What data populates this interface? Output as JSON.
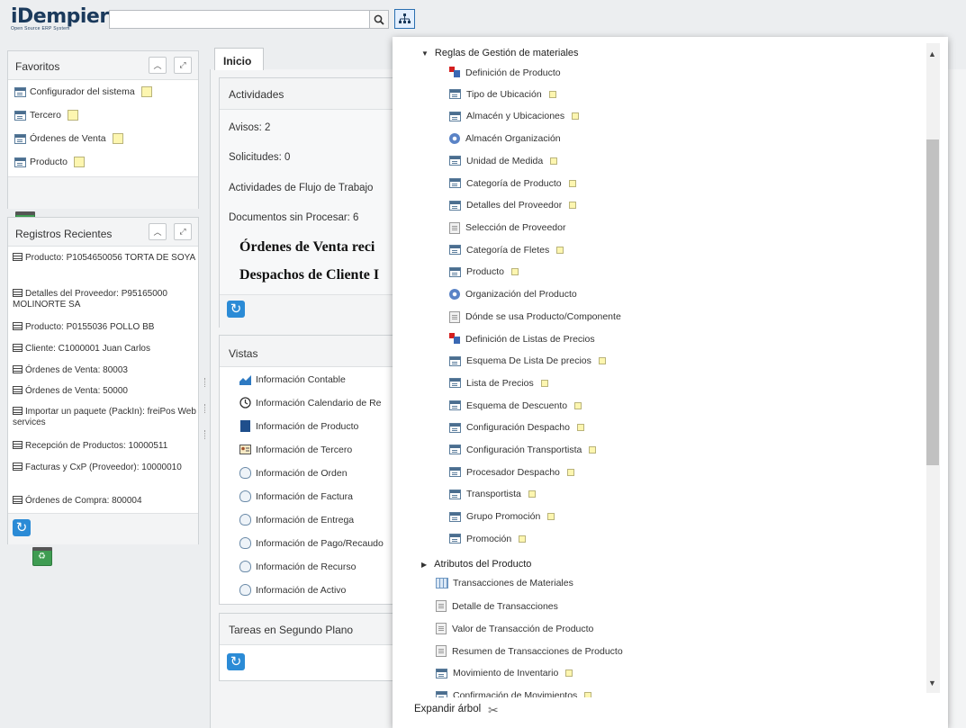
{
  "header": {
    "logo": "iDempiere",
    "logo_sub": "Open Source ERP System",
    "search_placeholder": "",
    "search_icon": "search-icon",
    "tree_icon": "sitemap-icon"
  },
  "favorites": {
    "title": "Favoritos",
    "items": [
      {
        "label": "Configurador del sistema"
      },
      {
        "label": "Tercero"
      },
      {
        "label": "Órdenes de Venta"
      },
      {
        "label": "Producto"
      }
    ]
  },
  "recent": {
    "title": "Registros Recientes",
    "items": [
      {
        "label": "Producto: P1054650056 TORTA DE SOYA"
      },
      {
        "label": "Detalles del Proveedor: P95165000 MOLINORTE SA"
      },
      {
        "label": "Producto: P0155036 POLLO BB"
      },
      {
        "label": "Cliente: C1000001 Juan Carlos"
      },
      {
        "label": "Órdenes de Venta: 80003"
      },
      {
        "label": "Órdenes de Venta: 50000"
      },
      {
        "label": "Importar un paquete (PackIn): freiPos Web services"
      },
      {
        "label": "Recepción de Productos: 10000511"
      },
      {
        "label": "Facturas y CxP (Proveedor): 10000010"
      },
      {
        "label": "Órdenes de Compra: 800004"
      }
    ]
  },
  "tabs": {
    "inicio": "Inicio"
  },
  "actividades": {
    "title": "Actividades",
    "avisos": "Avisos: 2",
    "solicitudes": "Solicitudes: 0",
    "flujo": "Actividades de Flujo de Trabajo",
    "docs": "Documentos sin Procesar: 6",
    "ordenes": "Órdenes de Venta reci",
    "despachos": "Despachos de Cliente I"
  },
  "vistas": {
    "title": "Vistas",
    "items": [
      {
        "label": "Información Contable",
        "icon": "chart-icon"
      },
      {
        "label": "Información Calendario de Re",
        "icon": "clock-icon"
      },
      {
        "label": "Información de Producto",
        "icon": "book-icon"
      },
      {
        "label": "Información de Tercero",
        "icon": "contact-card-icon"
      },
      {
        "label": "Información de Orden",
        "icon": "bulb-icon"
      },
      {
        "label": "Información de Factura",
        "icon": "bulb-icon"
      },
      {
        "label": "Información de Entrega",
        "icon": "bulb-icon"
      },
      {
        "label": "Información de Pago/Recaudo",
        "icon": "bulb-icon"
      },
      {
        "label": "Información de Recurso",
        "icon": "bulb-icon"
      },
      {
        "label": "Información de Activo",
        "icon": "bulb-icon"
      }
    ]
  },
  "tareas": {
    "title": "Tareas en Segundo Plano"
  },
  "menu_tree": {
    "group_open": "Reglas de Gestión de materiales",
    "items": [
      {
        "label": "Definición de Producto",
        "icon": "workflow-icon",
        "note": false
      },
      {
        "label": "Tipo de Ubicación",
        "icon": "window-icon",
        "note": true
      },
      {
        "label": "Almacén y Ubicaciones",
        "icon": "window-icon",
        "note": true
      },
      {
        "label": "Almacén Organización",
        "icon": "gear-icon",
        "note": false
      },
      {
        "label": "Unidad de Medida",
        "icon": "window-icon",
        "note": true
      },
      {
        "label": "Categoría de Producto",
        "icon": "window-icon",
        "note": true
      },
      {
        "label": "Detalles del Proveedor",
        "icon": "window-icon",
        "note": true
      },
      {
        "label": "Selección de Proveedor",
        "icon": "process-icon",
        "note": false
      },
      {
        "label": "Categoría de Fletes",
        "icon": "window-icon",
        "note": true
      },
      {
        "label": "Producto",
        "icon": "window-icon",
        "note": true
      },
      {
        "label": "Organización del Producto",
        "icon": "gear-icon",
        "note": false
      },
      {
        "label": "Dónde se usa Producto/Componente",
        "icon": "process-icon",
        "note": false
      },
      {
        "label": "Definición de Listas de Precios",
        "icon": "workflow-icon",
        "note": false
      },
      {
        "label": "Esquema De Lista De precios",
        "icon": "window-icon",
        "note": true
      },
      {
        "label": "Lista de Precios",
        "icon": "window-icon",
        "note": true
      },
      {
        "label": "Esquema de Descuento",
        "icon": "window-icon",
        "note": true
      },
      {
        "label": "Configuración Despacho",
        "icon": "window-icon",
        "note": true
      },
      {
        "label": "Configuración Transportista",
        "icon": "window-icon",
        "note": true
      },
      {
        "label": "Procesador Despacho",
        "icon": "window-icon",
        "note": true
      },
      {
        "label": "Transportista",
        "icon": "window-icon",
        "note": true
      },
      {
        "label": "Grupo Promoción",
        "icon": "window-icon",
        "note": true
      },
      {
        "label": "Promoción",
        "icon": "window-icon",
        "note": true
      }
    ],
    "group_closed": "Atributos del Producto",
    "items2": [
      {
        "label": "Transacciones de Materiales",
        "icon": "grid-icon",
        "note": false
      },
      {
        "label": "Detalle de Transacciones",
        "icon": "process-icon",
        "note": false
      },
      {
        "label": "Valor de Transacción de Producto",
        "icon": "process-icon",
        "note": false
      },
      {
        "label": "Resumen de Transacciones de Producto",
        "icon": "process-icon",
        "note": false
      },
      {
        "label": "Movimiento de Inventario",
        "icon": "window-icon",
        "note": true
      },
      {
        "label": "Confirmación de Movimientos",
        "icon": "window-icon",
        "note": true
      }
    ],
    "footer": "Expandir árbol"
  },
  "colors": {
    "brand": "#1b3a5c",
    "accent": "#2a6fb0"
  }
}
